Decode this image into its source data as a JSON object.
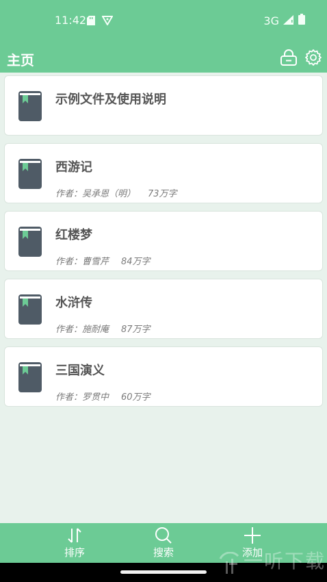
{
  "status_bar": {
    "time": "11:42",
    "network": "3G"
  },
  "app_bar": {
    "title": "主页",
    "icons": [
      "lock-icon",
      "gear-icon"
    ]
  },
  "books": [
    {
      "title": "示例文件及使用说明",
      "author_line": "",
      "word_count": ""
    },
    {
      "title": "西游记",
      "author_line": "作者：吴承恩（明）",
      "word_count": "73万字"
    },
    {
      "title": "红楼梦",
      "author_line": "作者：曹雪芹",
      "word_count": "84万字"
    },
    {
      "title": "水浒传",
      "author_line": "作者：施耐庵",
      "word_count": "87万字"
    },
    {
      "title": "三国演义",
      "author_line": "作者：罗贯中",
      "word_count": "60万字"
    }
  ],
  "bottom_nav": {
    "sort_label": "排序",
    "search_label": "搜索",
    "add_label": "添加"
  },
  "watermark": "一听下载",
  "colors": {
    "primary": "#6ccb95",
    "background": "#e8f2ec",
    "book_cover": "#4f5b66",
    "bookmark": "#6ccb95"
  }
}
